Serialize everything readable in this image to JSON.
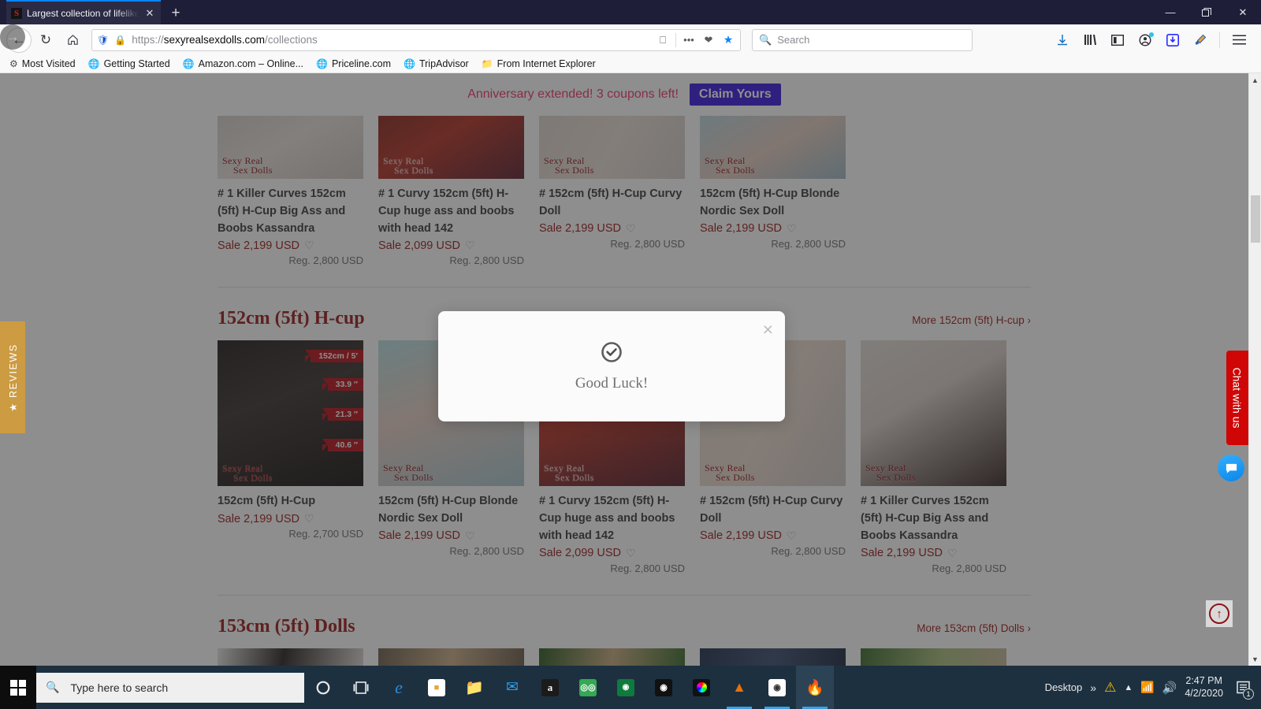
{
  "browser": {
    "tab": {
      "title": "Largest collection of lifelike adu",
      "favicon_letter": "S",
      "close_icon": "close-icon"
    },
    "new_tab_label": "+",
    "window_controls": {
      "minimize": "—",
      "maximize": "❐",
      "close": "✕"
    },
    "nav": {
      "back": "←",
      "forward": "→",
      "reload": "↻",
      "home": "⌂"
    },
    "url": {
      "protocol": "https://",
      "host": "sexyrealsexdolls.com",
      "path": "/collections",
      "reader_icon": "reader-mode-icon",
      "more_icon": "•••",
      "pocket_icon": "pocket-icon",
      "star_icon": "★"
    },
    "search_placeholder": "Search",
    "toolbar_icons": [
      "download-icon",
      "library-icon",
      "sidebar-icon",
      "account-icon",
      "blue-download-icon",
      "highlighter-icon",
      "menu-icon"
    ],
    "bookmarks": [
      {
        "label": "Most Visited",
        "icon": "gear-icon"
      },
      {
        "label": "Getting Started",
        "icon": "globe-icon"
      },
      {
        "label": "Amazon.com – Online...",
        "icon": "globe-icon"
      },
      {
        "label": "Priceline.com",
        "icon": "globe-icon"
      },
      {
        "label": "TripAdvisor",
        "icon": "globe-icon"
      },
      {
        "label": "From Internet Explorer",
        "icon": "folder-icon"
      }
    ]
  },
  "promo": {
    "text": "Anniversary extended! 3 coupons left!",
    "button_label": "Claim Yours",
    "text_color": "#f0356a",
    "button_color": "#3a1ae0"
  },
  "modal": {
    "icon": "check-circle-icon",
    "text": "Good Luck!",
    "close_label": "×"
  },
  "side_tabs": {
    "reviews": {
      "label": "★ REVIEWS",
      "color": "#cc9b42"
    },
    "chat": {
      "label": "Chat with us",
      "color": "#d00505",
      "bubble_icon": "chat-bubble-icon"
    }
  },
  "back_to_top": {
    "icon": "arrow-up-icon"
  },
  "watermark": {
    "line1": "Sexy Real",
    "line2": "Sex Dolls"
  },
  "rows": [
    {
      "section": null,
      "products": [
        {
          "title": "# 1 Killer Curves 152cm (5ft) H-Cup Big Ass and Boobs Kassandra",
          "sale": "Sale 2,199 USD",
          "reg": "Reg. 2,800 USD",
          "img": "bed-white-sheets"
        },
        {
          "title": "# 1 Curvy 152cm (5ft) H-Cup huge ass and boobs with head 142",
          "sale": "Sale 2,099 USD",
          "reg": "Reg. 2,800 USD",
          "img": "red-dress-dark-hair"
        },
        {
          "title": "# 152cm (5ft) H-Cup Curvy Doll",
          "sale": "Sale 2,199 USD",
          "reg": "Reg. 2,800 USD",
          "img": "standing-window"
        },
        {
          "title": "152cm (5ft) H-Cup Blonde Nordic Sex Doll",
          "sale": "Sale 2,199 USD",
          "reg": "Reg. 2,800 USD",
          "img": "red-white-bikini"
        }
      ]
    }
  ],
  "sections": [
    {
      "title": "152cm (5ft) H-cup",
      "more_label": "More 152cm (5ft) H-cup ›",
      "products": [
        {
          "title": "152cm (5ft) H-Cup",
          "sale": "Sale 2,199 USD",
          "reg": "Reg. 2,700 USD",
          "img": "dark-studio-measurements",
          "measurements": [
            "152cm / 5′",
            "33.9 ″",
            "21.3 ″",
            "40.6 ″"
          ]
        },
        {
          "title": "152cm (5ft) H-Cup Blonde Nordic Sex Doll",
          "sale": "Sale 2,199 USD",
          "reg": "Reg. 2,800 USD",
          "img": "blonde-white-hat"
        },
        {
          "title": "# 1 Curvy 152cm (5ft) H-Cup huge ass and boobs with head 142",
          "sale": "Sale 2,099 USD",
          "reg": "Reg. 2,800 USD",
          "img": "red-dress-dark-hair"
        },
        {
          "title": "# 152cm (5ft) H-Cup Curvy Doll",
          "sale": "Sale 2,199 USD",
          "reg": "Reg. 2,800 USD",
          "img": "standing-window"
        },
        {
          "title": "# 1 Killer Curves 152cm (5ft) H-Cup Big Ass and Boobs Kassandra",
          "sale": "Sale 2,199 USD",
          "reg": "Reg. 2,800 USD",
          "img": "lying-bed-brunette"
        }
      ]
    },
    {
      "title": "153cm (5ft) Dolls",
      "more_label": "More 153cm (5ft) Dolls ›",
      "products": [
        {
          "img": "dark-hair-amor"
        },
        {
          "img": "blonde-indoor"
        },
        {
          "img": "outdoor-green"
        },
        {
          "img": "denim-blue"
        },
        {
          "img": "garden-blonde"
        }
      ]
    }
  ],
  "taskbar": {
    "search_placeholder": "Type here to search",
    "items": [
      "cortana-icon",
      "task-view-icon",
      "edge-icon",
      "store-icon",
      "file-explorer-icon",
      "mail-icon",
      "amazon-icon",
      "tripadvisor-icon",
      "green-app-icon",
      "camera-dark-icon",
      "color-wheel-icon",
      "vlc-icon",
      "camera-icon",
      "firefox-icon"
    ],
    "desktop_label": "Desktop",
    "overflow_label": "»",
    "tray": [
      "warning-icon",
      "chevron-up-icon",
      "network-icon",
      "volume-icon"
    ],
    "time": "2:47 PM",
    "date": "4/2/2020",
    "notification_count": "1"
  }
}
